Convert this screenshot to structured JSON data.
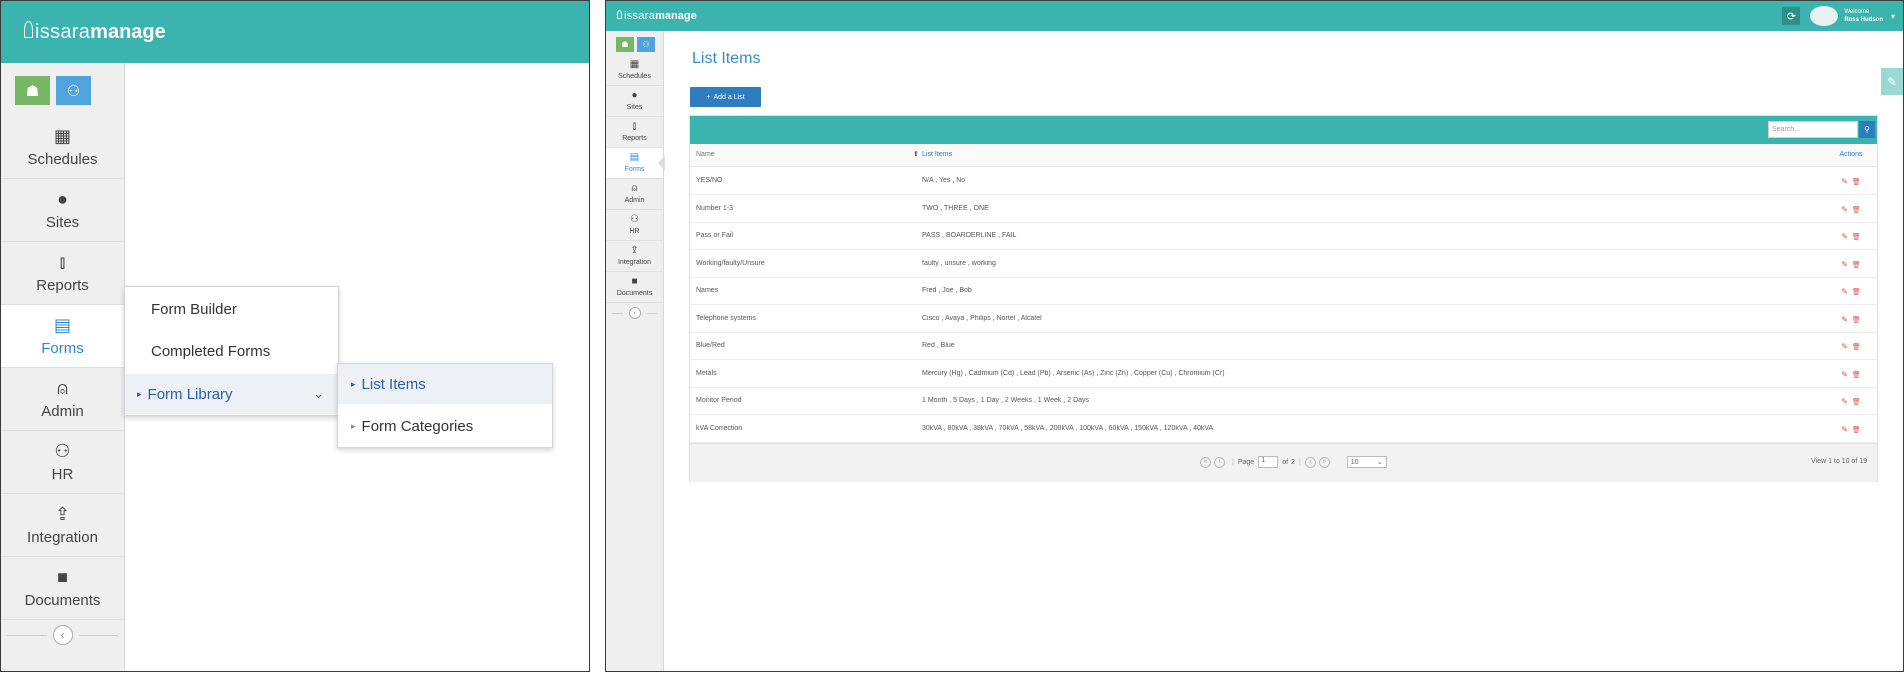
{
  "left": {
    "logo": {
      "part1": "issara",
      "part2": "manage"
    },
    "nav": [
      {
        "label": "Schedules",
        "icon": "calendar-icon",
        "glyph": "▦"
      },
      {
        "label": "Sites",
        "icon": "globe-icon",
        "glyph": "●"
      },
      {
        "label": "Reports",
        "icon": "bar-chart-icon",
        "glyph": "⫾"
      },
      {
        "label": "Forms",
        "icon": "file-icon",
        "glyph": "▤",
        "active": true
      },
      {
        "label": "Admin",
        "icon": "user-icon",
        "glyph": "⍝"
      },
      {
        "label": "HR",
        "icon": "users-icon",
        "glyph": "⚇"
      },
      {
        "label": "Integration",
        "icon": "upload-icon",
        "glyph": "⇪"
      },
      {
        "label": "Documents",
        "icon": "folder-icon",
        "glyph": "■"
      }
    ],
    "menu": {
      "form_builder": "Form Builder",
      "completed_forms": "Completed Forms",
      "form_library": "Form Library"
    },
    "submenu": {
      "list_items": "List Items",
      "form_categories": "Form Categories"
    }
  },
  "right": {
    "logo": {
      "part1": "issara",
      "part2": "manage"
    },
    "welcome": "Welcome",
    "user_name": "Ross Hudson",
    "page_title": "List Items",
    "add_button": "Add a List",
    "search_placeholder": "Search...",
    "columns": {
      "name": "Name",
      "list_items": "List Items",
      "actions": "Actions"
    },
    "nav": [
      {
        "label": "Schedules",
        "glyph": "▦"
      },
      {
        "label": "Sites",
        "glyph": "●"
      },
      {
        "label": "Reports",
        "glyph": "⫾"
      },
      {
        "label": "Forms",
        "glyph": "▤",
        "active": true
      },
      {
        "label": "Admin",
        "glyph": "⍝"
      },
      {
        "label": "HR",
        "glyph": "⚇"
      },
      {
        "label": "Integration",
        "glyph": "⇪"
      },
      {
        "label": "Documents",
        "glyph": "■"
      }
    ],
    "rows": [
      {
        "name": "YES/NO",
        "items": "N/A , Yes , No"
      },
      {
        "name": "Number 1-3",
        "items": "TWO , THREE , ONE"
      },
      {
        "name": "Pass or Fail",
        "items": "PASS , BOARDERLINE , FAIL"
      },
      {
        "name": "Working/faulty/Unsure",
        "items": "faulty , unsure , working"
      },
      {
        "name": "Names",
        "items": "Fred , Joe , Bob"
      },
      {
        "name": "Telephone systems",
        "items": "Cisco , Avaya , Philips , Nortel , Alcatel"
      },
      {
        "name": "Blue/Red",
        "items": "Red , Blue"
      },
      {
        "name": "Metals",
        "items": "Mercury (Hg) , Cadmium (Cd) , Lead (Pb) , Arsenic (As) , Zinc (Zn) , Copper (Cu) , Chromium (Cr)"
      },
      {
        "name": "Monitor Period",
        "items": "1 Month , 5 Days , 1 Day , 2 Weeks , 1 Week , 2 Days"
      },
      {
        "name": "kVA Correction",
        "items": "30kVA , 80kVA , 38kVA , 70kVA , 58kVA , 200kVA , 100kVA , 60kVA , 150kVA , 120kVA , 40kVA"
      }
    ],
    "pager": {
      "page_label": "Page",
      "page_value": "1",
      "of_label": "of",
      "total_pages": "2",
      "per_page": "10",
      "view_info": "View 1 to 10 of 19"
    },
    "colors": {
      "teal": "#3bb3ae",
      "blue": "#2f7dc1",
      "green": "#75b764"
    }
  }
}
